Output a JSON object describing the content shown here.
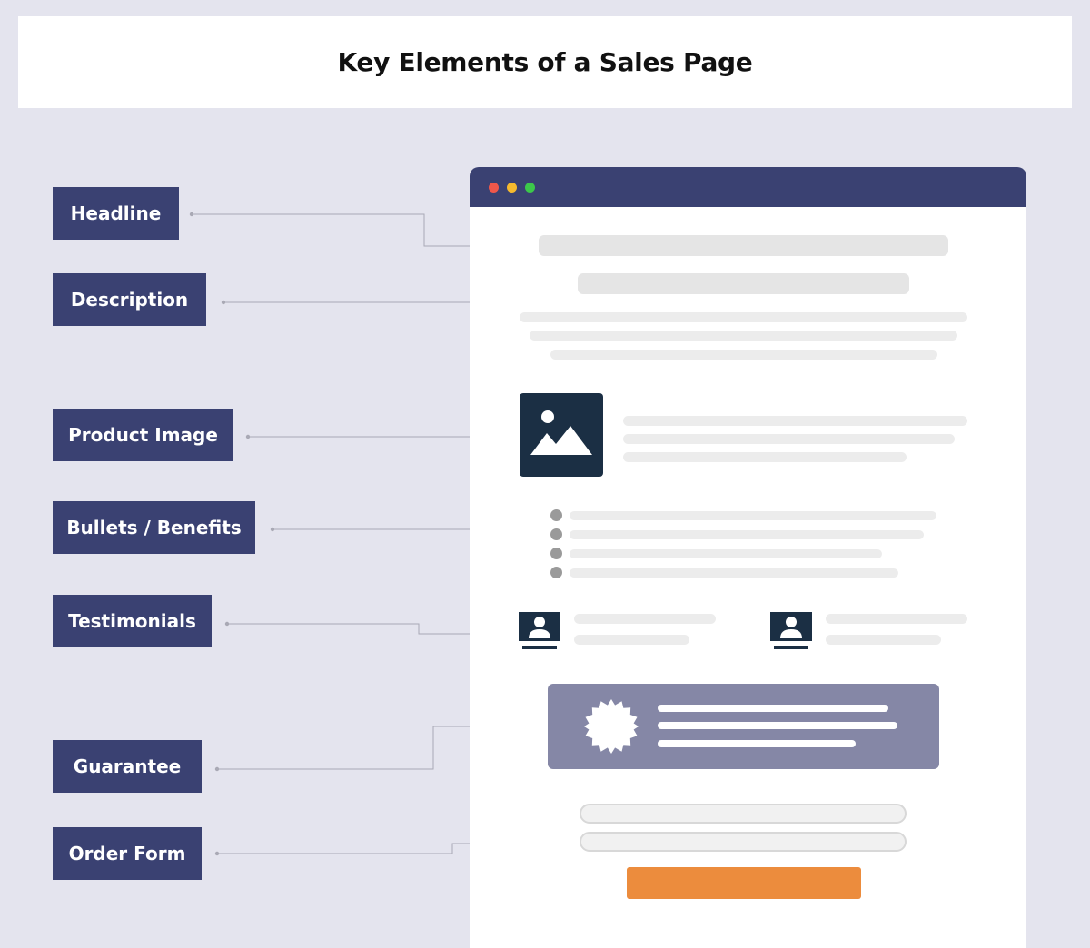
{
  "title": "Key Elements of a Sales Page",
  "labels": {
    "headline": "Headline",
    "description": "Description",
    "product_image": "Product Image",
    "bullets": "Bullets / Benefits",
    "testimonials": "Testimonials",
    "guarantee": "Guarantee",
    "order_form": "Order Form"
  },
  "icons": {
    "product_image": "image-icon",
    "testimonial": "user-avatar-icon",
    "guarantee": "badge-seal-icon"
  },
  "colors": {
    "background": "#e4e4ee",
    "label_bg": "#3a4172",
    "browser_bar": "#3a4172",
    "dot_red": "#f0574a",
    "dot_yellow": "#f5b92e",
    "dot_green": "#3cc84a",
    "guarantee_bg": "#8587a6",
    "button": "#ec8c3d",
    "image_bg": "#1b2f44"
  }
}
